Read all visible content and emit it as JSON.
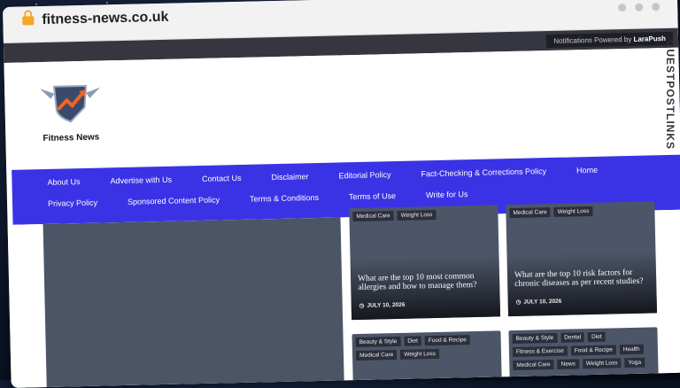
{
  "browser": {
    "url": "fitness-news.co.uk"
  },
  "notification_bar": {
    "prefix": "Notifications Powered by",
    "brand": "LaraPush"
  },
  "site": {
    "logo_text": "Fitness News"
  },
  "nav": [
    "About Us",
    "Advertise with Us",
    "Contact Us",
    "Disclaimer",
    "Editorial Policy",
    "Fact-Checking & Corrections Policy",
    "Home",
    "Privacy Policy",
    "Sponsored Content Policy",
    "Terms & Conditions",
    "Terms of Use",
    "Write for Us"
  ],
  "cards": [
    {
      "tags": [
        "Medical Care",
        "Weight Loss"
      ],
      "title": "What are the top 10 most common allergies and how to manage them?",
      "date": "JULY 10, 2026"
    },
    {
      "tags": [
        "Medical Care",
        "Weight Loss"
      ],
      "title": "What are the top 10 risk factors for chronic diseases as per recent studies?",
      "date": "JULY 10, 2026"
    },
    {
      "tags": [
        "Beauty & Style",
        "Diet",
        "Food & Recipe",
        "Medical Care",
        "Weight Loss"
      ]
    },
    {
      "tags": [
        "Beauty & Style",
        "Dental",
        "Diet",
        "Fitness & Exercise",
        "Food & Recipe",
        "Health",
        "Medical Care",
        "News",
        "Weight Loss",
        "Yoga"
      ]
    }
  ],
  "watermark": {
    "text": "GUESTPOSTLINKS"
  },
  "colors": {
    "nav_bg": "#3a33e6",
    "card_bg": "#4d5668",
    "lock": "#f5a623"
  }
}
